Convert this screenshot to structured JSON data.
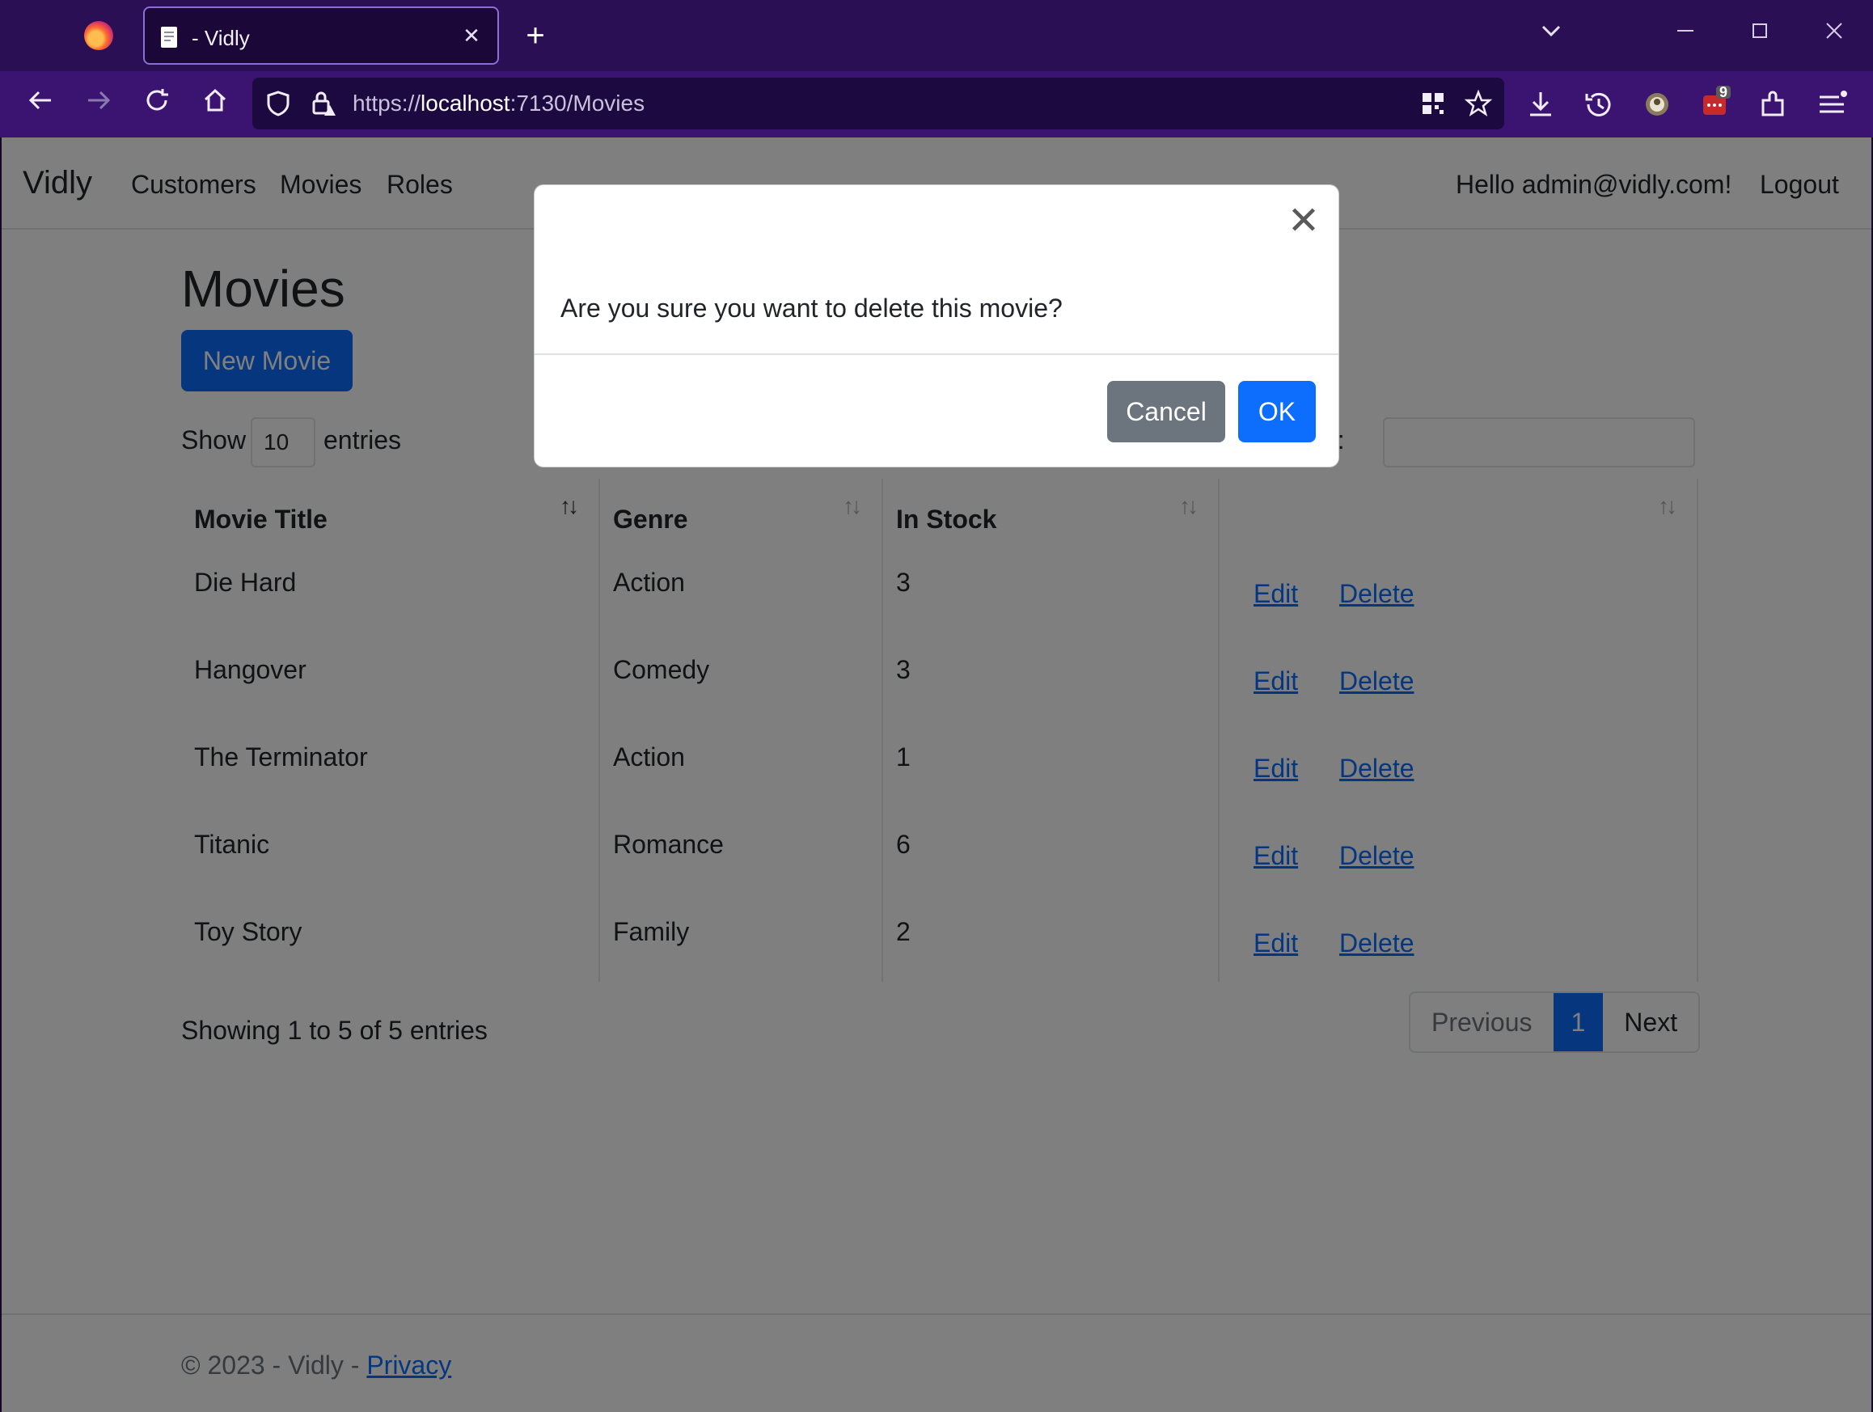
{
  "browser": {
    "tab_title": "- Vidly",
    "url_scheme": "https://",
    "url_host": "localhost",
    "url_rest": ":7130/Movies",
    "notification_badge": "9",
    "accent": "#2b0f55"
  },
  "site": {
    "brand": "Vidly",
    "nav": [
      "Customers",
      "Movies",
      "Roles"
    ],
    "greeting": "Hello admin@vidly.com!",
    "logout": "Logout"
  },
  "page": {
    "title": "Movies",
    "new_button": "New Movie",
    "show_label": "Show",
    "entries_label": "entries",
    "page_length": "10",
    "search_label": "ch:"
  },
  "table": {
    "headers": [
      "Movie Title",
      "Genre",
      "In Stock",
      ""
    ],
    "rows": [
      {
        "title": "Die Hard",
        "genre": "Action",
        "stock": "3",
        "edit": "Edit",
        "delete": "Delete"
      },
      {
        "title": "Hangover",
        "genre": "Comedy",
        "stock": "3",
        "edit": "Edit",
        "delete": "Delete"
      },
      {
        "title": "The Terminator",
        "genre": "Action",
        "stock": "1",
        "edit": "Edit",
        "delete": "Delete"
      },
      {
        "title": "Titanic",
        "genre": "Romance",
        "stock": "6",
        "edit": "Edit",
        "delete": "Delete"
      },
      {
        "title": "Toy Story",
        "genre": "Family",
        "stock": "2",
        "edit": "Edit",
        "delete": "Delete"
      }
    ]
  },
  "pagination": {
    "info": "Showing 1 to 5 of 5 entries",
    "previous": "Previous",
    "current": "1",
    "next": "Next"
  },
  "footer": {
    "text": "© 2023 - Vidly - ",
    "privacy": "Privacy"
  },
  "modal": {
    "message": "Are you sure you want to delete this movie?",
    "cancel": "Cancel",
    "ok": "OK",
    "close_glyph": "✕"
  },
  "colors": {
    "primary": "#0d6efd",
    "secondary": "#6c757d"
  }
}
